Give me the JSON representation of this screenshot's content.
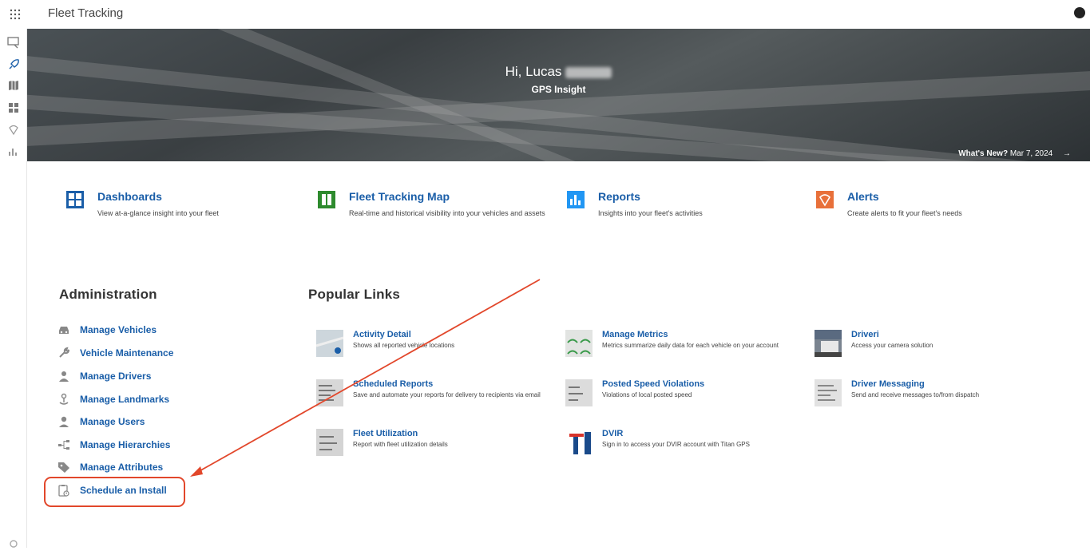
{
  "header": {
    "app_title": "Fleet Tracking"
  },
  "hero": {
    "greeting": "Hi, Lucas",
    "company": "GPS Insight",
    "whats_new_label": "What's New?",
    "whats_new_date": "Mar 7, 2024",
    "whats_new_arrow": "→"
  },
  "cards": [
    {
      "title": "Dashboards",
      "desc": "View at-a-glance insight into your fleet",
      "icon": "dashboard-icon",
      "color": "#1a5ea8"
    },
    {
      "title": "Fleet Tracking Map",
      "desc": "Real-time and historical visibility into your vehicles and assets",
      "icon": "map-icon",
      "color": "#2e8b2e"
    },
    {
      "title": "Reports",
      "desc": "Insights into your fleet's activities",
      "icon": "reports-icon",
      "color": "#2196f3"
    },
    {
      "title": "Alerts",
      "desc": "Create alerts to fit your fleet's needs",
      "icon": "alerts-icon",
      "color": "#e8703a"
    }
  ],
  "administration": {
    "title": "Administration",
    "items": [
      {
        "label": "Manage Vehicles",
        "icon": "car-icon"
      },
      {
        "label": "Vehicle Maintenance",
        "icon": "wrench-icon"
      },
      {
        "label": "Manage Drivers",
        "icon": "driver-icon"
      },
      {
        "label": "Manage Landmarks",
        "icon": "landmark-icon"
      },
      {
        "label": "Manage Users",
        "icon": "user-icon"
      },
      {
        "label": "Manage Hierarchies",
        "icon": "hierarchy-icon"
      },
      {
        "label": "Manage Attributes",
        "icon": "tag-icon"
      },
      {
        "label": "Schedule an Install",
        "icon": "clipboard-clock-icon"
      }
    ]
  },
  "popular_links": {
    "title": "Popular Links",
    "items": [
      {
        "title": "Activity Detail",
        "desc": "Shows all reported vehicle locations"
      },
      {
        "title": "Manage Metrics",
        "desc": "Metrics summarize daily data for each vehicle on your account"
      },
      {
        "title": "Driveri",
        "desc": "Access your camera solution"
      },
      {
        "title": "Scheduled Reports",
        "desc": "Save and automate your reports for delivery to recipients via email"
      },
      {
        "title": "Posted Speed Violations",
        "desc": "Violations of local posted speed"
      },
      {
        "title": "Driver Messaging",
        "desc": "Send and receive messages to/from dispatch"
      },
      {
        "title": "Fleet Utilization",
        "desc": "Report with fleet utilization details"
      },
      {
        "title": "DVIR",
        "desc": "Sign in to access your DVIR account with Titan GPS"
      }
    ]
  },
  "colors": {
    "link": "#1a5ea8",
    "annotation": "#e2472b"
  }
}
